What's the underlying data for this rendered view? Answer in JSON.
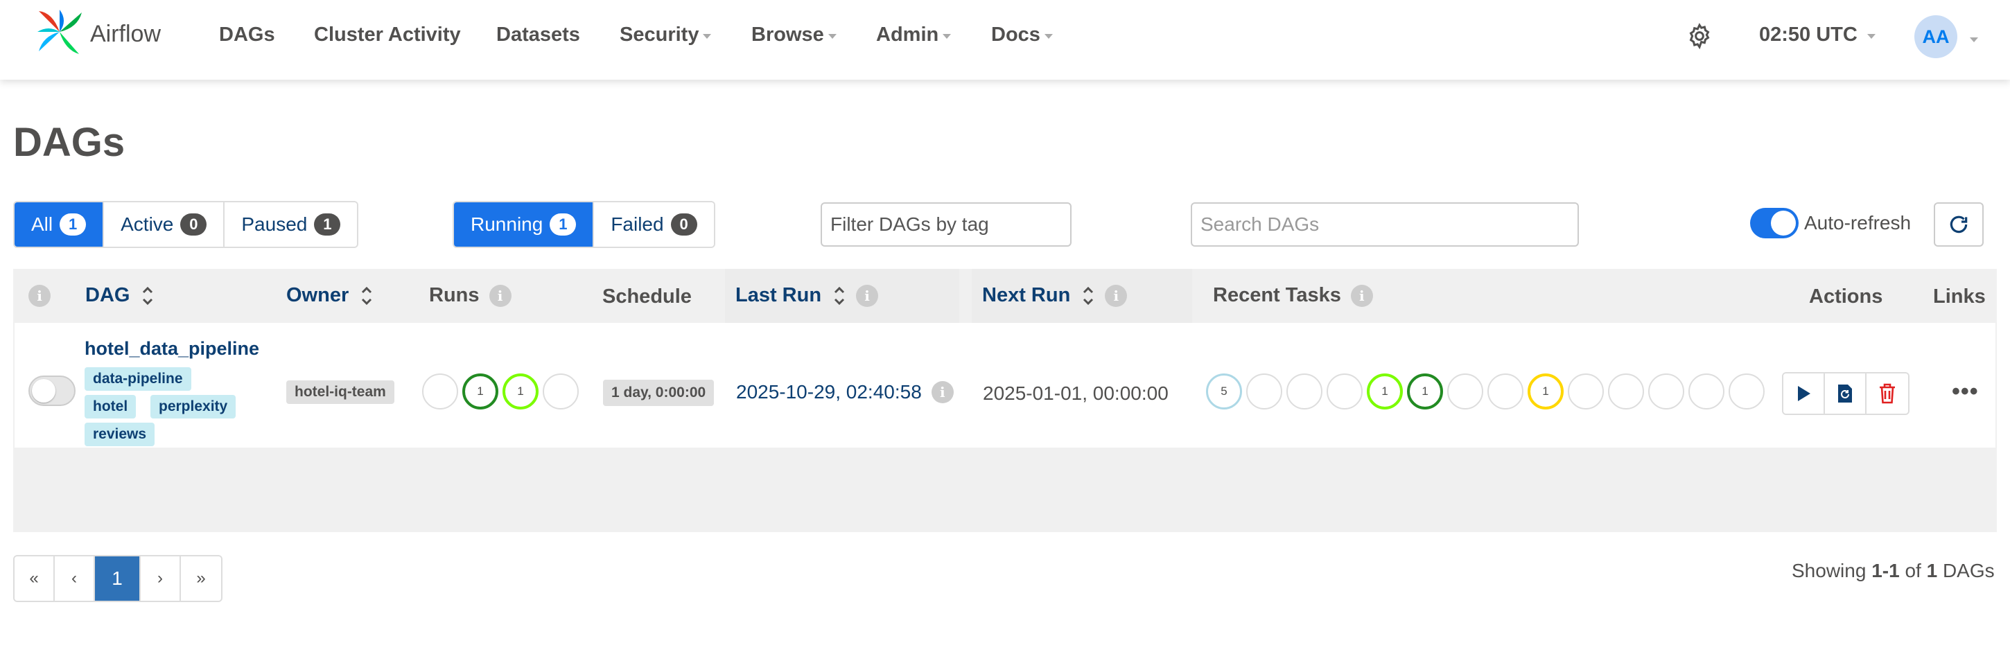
{
  "brand": {
    "name": "Airflow"
  },
  "nav": {
    "items": [
      {
        "label": "DAGs"
      },
      {
        "label": "Cluster Activity"
      },
      {
        "label": "Datasets"
      },
      {
        "label": "Security"
      },
      {
        "label": "Browse"
      },
      {
        "label": "Admin"
      },
      {
        "label": "Docs"
      }
    ],
    "time": "02:50 UTC",
    "avatar": "AA"
  },
  "page": {
    "title": "DAGs"
  },
  "filters": {
    "status": [
      {
        "label": "All",
        "count": "1",
        "active": true
      },
      {
        "label": "Active",
        "count": "0",
        "active": false
      },
      {
        "label": "Paused",
        "count": "1",
        "active": false
      }
    ],
    "runs": [
      {
        "label": "Running",
        "count": "1",
        "active": true
      },
      {
        "label": "Failed",
        "count": "0",
        "active": false
      }
    ],
    "tag_filter_placeholder": "Filter DAGs by tag",
    "search_placeholder": "Search DAGs",
    "auto_refresh_label": "Auto-refresh",
    "auto_refresh_on": true
  },
  "table": {
    "headers": {
      "dag": "DAG",
      "owner": "Owner",
      "runs": "Runs",
      "schedule": "Schedule",
      "last_run": "Last Run",
      "next_run": "Next Run",
      "recent_tasks": "Recent Tasks",
      "actions": "Actions",
      "links": "Links"
    },
    "rows": [
      {
        "dag_id": "hotel_data_pipeline",
        "tags": [
          "data-pipeline",
          "hotel",
          "perplexity",
          "reviews"
        ],
        "owner": "hotel-iq-team",
        "runs": [
          "",
          "1",
          "1",
          ""
        ],
        "schedule": "1 day, 0:00:00",
        "last_run": "2025-10-29, 02:40:58",
        "next_run": "2025-01-01, 00:00:00",
        "recent_tasks": [
          "5",
          "",
          "",
          "",
          "1",
          "1",
          "",
          "",
          "1",
          "",
          "",
          "",
          "",
          ""
        ],
        "paused": true
      }
    ]
  },
  "pagination": {
    "first": "«",
    "prev": "‹",
    "current": "1",
    "next": "›",
    "last": "»",
    "showing_prefix": "Showing",
    "range": "1-1",
    "of": "of",
    "total": "1",
    "suffix": "DAGs"
  },
  "colors": {
    "running": "#1a73e8",
    "success": "#228b22",
    "running_task": "#7cfc00",
    "queued": "#ffd700",
    "scheduled": "#add8e6"
  }
}
